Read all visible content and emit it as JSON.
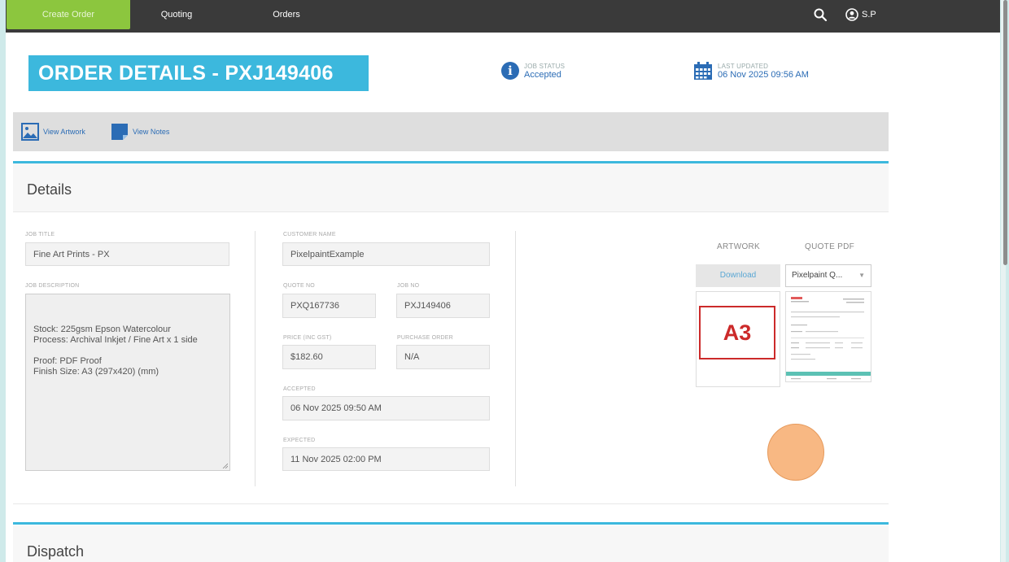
{
  "nav": {
    "tabs": [
      "Create Order",
      "Quoting",
      "Orders"
    ],
    "user": "S.P"
  },
  "header": {
    "order_title": "ORDER DETAILS - PXJ149406",
    "job_status_label": "JOB STATUS",
    "job_status_value": "Accepted",
    "last_updated_label": "LAST UPDATED",
    "last_updated_value": "06 Nov 2025 09:56 AM"
  },
  "toolbar": {
    "view_artwork": "View Artwork",
    "view_notes": "View Notes"
  },
  "details": {
    "title": "Details",
    "job_title_label": "JOB TITLE",
    "job_title_value": "Fine Art Prints - PX",
    "job_description_label": "JOB DESCRIPTION",
    "job_description_value": "Stock: 225gsm Epson Watercolour\nProcess: Archival Inkjet / Fine Art x 1 side\n\nProof: PDF Proof\nFinish Size: A3 (297x420) (mm)",
    "customer_name_label": "CUSTOMER NAME",
    "customer_name_value": "PixelpaintExample",
    "quote_no_label": "QUOTE NO",
    "quote_no_value": "PXQ167736",
    "job_no_label": "JOB NO",
    "job_no_value": "PXJ149406",
    "price_label": "PRICE (INC GST)",
    "price_value": "$182.60",
    "purchase_order_label": "PURCHASE ORDER",
    "purchase_order_value": "N/A",
    "accepted_label": "ACCEPTED",
    "accepted_value": "06 Nov 2025 09:50 AM",
    "expected_label": "EXPECTED",
    "expected_value": "11 Nov 2025 02:00 PM",
    "artwork_head": "ARTWORK",
    "quote_pdf_head": "QUOTE PDF",
    "download_label": "Download",
    "quote_pdf_selected": "Pixelpaint Q...",
    "artwork_thumb_text": "A3"
  },
  "dispatch": {
    "title": "Dispatch"
  },
  "colors": {
    "accent_blue": "#3cb8dd",
    "nav_active_green": "#8cc63e",
    "a3_red": "#cc2a2a"
  }
}
